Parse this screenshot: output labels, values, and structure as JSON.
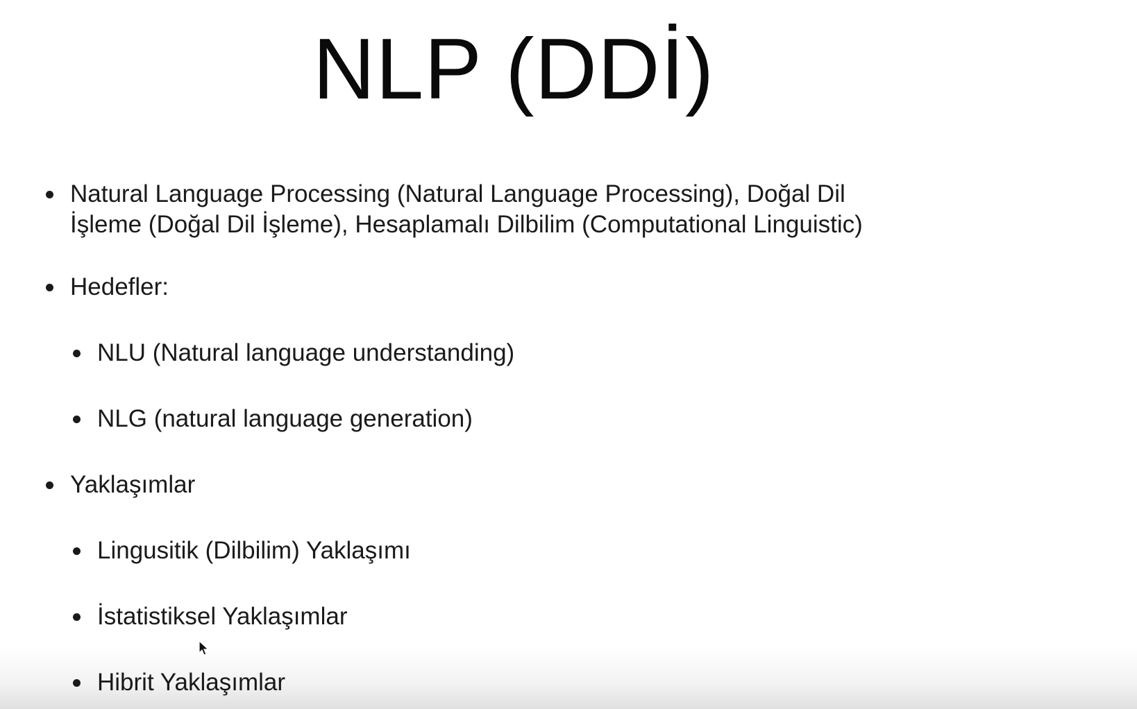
{
  "slide": {
    "title": "NLP (DDİ)",
    "bullets": [
      {
        "level": 1,
        "lines": [
          "Natural Language Processing (Natural Language Processing), Doğal Dil",
          "İşleme (Doğal Dil İşleme), Hesaplamalı Dilbilim (Computational Linguistic)"
        ]
      },
      {
        "level": 1,
        "text": "Hedefler:"
      },
      {
        "level": 2,
        "text": "NLU (Natural language understanding)"
      },
      {
        "level": 2,
        "text": "NLG (natural language generation)"
      },
      {
        "level": 1,
        "text": "Yaklaşımlar"
      },
      {
        "level": 2,
        "text": "Lingusitik (Dilbilim) Yaklaşımı"
      },
      {
        "level": 2,
        "text": "İstatistiksel Yaklaşımlar"
      },
      {
        "level": 2,
        "text": "Hibrit Yaklaşımlar"
      }
    ]
  },
  "icons": {
    "cursor": "mouse-pointer-icon",
    "bullet": "bullet-dot-icon"
  },
  "colors": {
    "background": "#ffffff",
    "text": "#1a1a1a"
  }
}
